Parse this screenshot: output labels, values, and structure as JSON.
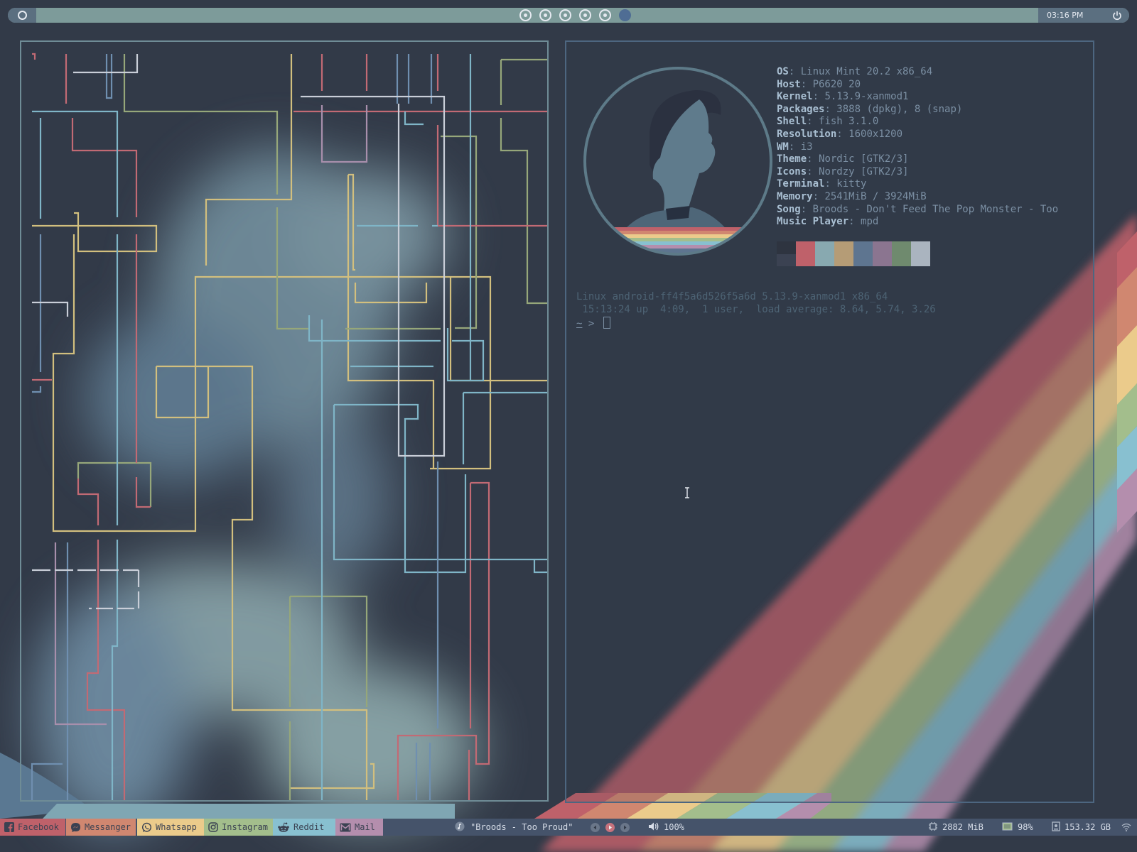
{
  "topbar": {
    "menu_icon": "circle-ring-icon",
    "workspaces": [
      "1",
      "2",
      "3",
      "4",
      "5",
      "6"
    ],
    "active_workspace": 6,
    "clock": "03:16 PM",
    "power_icon": "power-icon"
  },
  "terminal": {
    "sysinfo": [
      {
        "key": "OS",
        "value": "Linux Mint 20.2 x86_64"
      },
      {
        "key": "Host",
        "value": "P6620 20"
      },
      {
        "key": "Kernel",
        "value": "5.13.9-xanmod1"
      },
      {
        "key": "Packages",
        "value": "3888 (dpkg), 8 (snap)"
      },
      {
        "key": "Shell",
        "value": "fish 3.1.0"
      },
      {
        "key": "Resolution",
        "value": "1600x1200"
      },
      {
        "key": "WM",
        "value": "i3"
      },
      {
        "key": "Theme",
        "value": "Nordic [GTK2/3]"
      },
      {
        "key": "Icons",
        "value": "Nordzy [GTK2/3]"
      },
      {
        "key": "Terminal",
        "value": "kitty"
      },
      {
        "key": "Memory",
        "value": "2541MiB / 3924MiB"
      },
      {
        "key": "Song",
        "value": "Broods - Don't Feed The Pop Monster - Too"
      },
      {
        "key": "Music Player",
        "value": "mpd"
      }
    ],
    "palette": [
      {
        "top": "#2e3440",
        "bottom": "#3b4252"
      },
      {
        "top": "#bf616a",
        "bottom": "#bf616a"
      },
      {
        "top": "#88a9b0",
        "bottom": "#88a9b0"
      },
      {
        "top": "#b59c76",
        "bottom": "#b59c76"
      },
      {
        "top": "#5e7590",
        "bottom": "#5e7590"
      },
      {
        "top": "#8b7590",
        "bottom": "#8b7590"
      },
      {
        "top": "#6f8a6e",
        "bottom": "#6f8a6e"
      },
      {
        "top": "#aab4bf",
        "bottom": "#aab4bf"
      }
    ],
    "motd_line1": "Linux android-ff4f5a6d526f5a6d 5.13.9-xanmod1 x86_64",
    "motd_line2": " 15:13:24 up  4:09,  1 user,  load average: 8.64, 5.74, 3.26",
    "prompt_tilde": "~",
    "prompt_arrow": " > "
  },
  "bottombar": {
    "apps": [
      {
        "label": "Facebook",
        "icon": "facebook-icon",
        "color": "#bf616a"
      },
      {
        "label": "Messanger",
        "icon": "messenger-icon",
        "color": "#d08770"
      },
      {
        "label": "Whatsapp",
        "icon": "whatsapp-icon",
        "color": "#ebcb8b"
      },
      {
        "label": "Instagram",
        "icon": "instagram-icon",
        "color": "#a3be8c"
      },
      {
        "label": "Reddit",
        "icon": "reddit-icon",
        "color": "#88c0d0"
      },
      {
        "label": "Mail",
        "icon": "mail-icon",
        "color": "#b48ead"
      }
    ],
    "now_playing": "\"Broods - Too Proud\"",
    "volume": "100%",
    "memory": "2882 MiB",
    "battery": "98%",
    "disk": "153.32 GB"
  }
}
